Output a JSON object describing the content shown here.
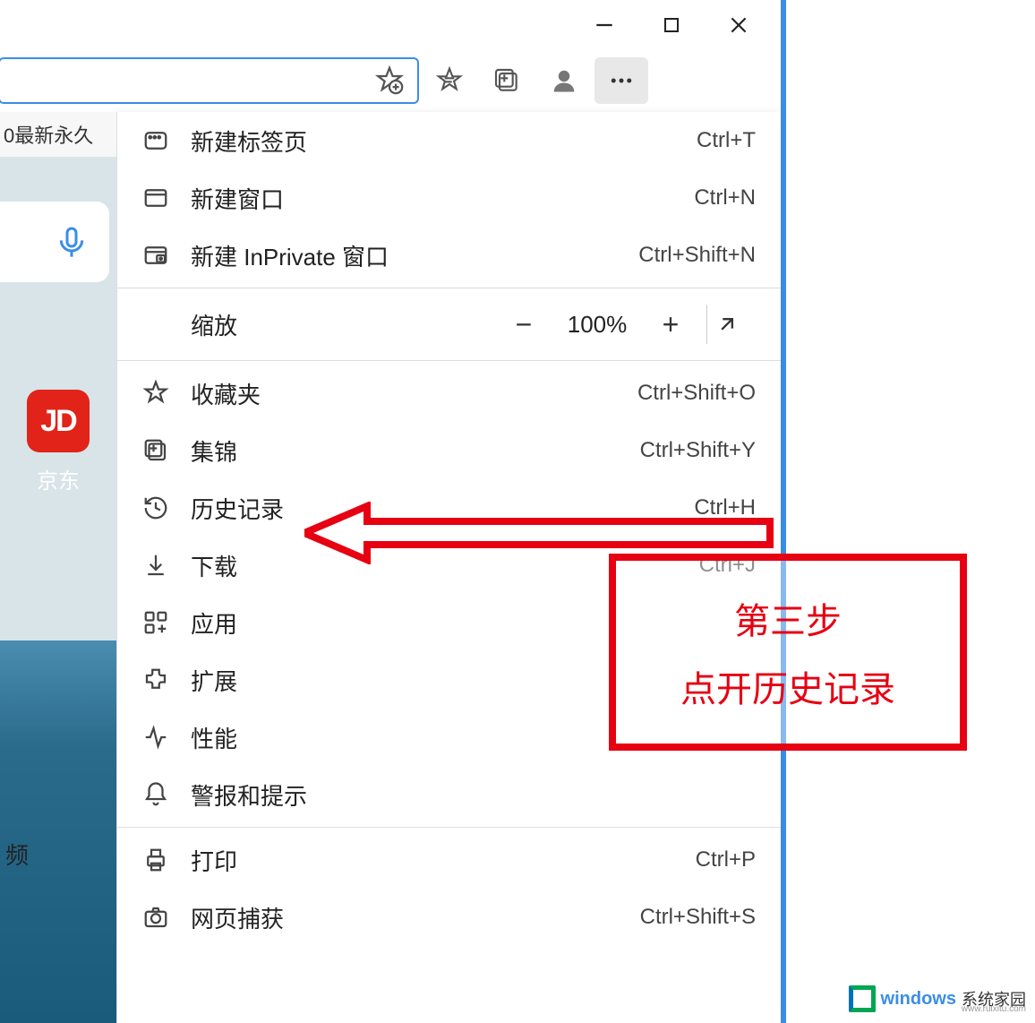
{
  "titlebar": {
    "minimize": "minimize",
    "maximize": "maximize",
    "close": "close"
  },
  "toolbar": {
    "favorites_icon": "favorites",
    "collections_icon": "collections",
    "profile_icon": "profile",
    "more_icon": "more"
  },
  "bookmark_strip": "0最新永久",
  "page": {
    "jd_icon_text": "JD",
    "jd_label": "京东",
    "bottom_label": "频"
  },
  "menu": {
    "new_tab": {
      "label": "新建标签页",
      "shortcut": "Ctrl+T"
    },
    "new_window": {
      "label": "新建窗口",
      "shortcut": "Ctrl+N"
    },
    "new_inprivate": {
      "label": "新建 InPrivate 窗口",
      "shortcut": "Ctrl+Shift+N"
    },
    "zoom": {
      "label": "缩放",
      "value": "100%"
    },
    "favorites": {
      "label": "收藏夹",
      "shortcut": "Ctrl+Shift+O"
    },
    "collections": {
      "label": "集锦",
      "shortcut": "Ctrl+Shift+Y"
    },
    "history": {
      "label": "历史记录",
      "shortcut": "Ctrl+H"
    },
    "downloads": {
      "label": "下载",
      "shortcut": "Ctrl+J"
    },
    "apps": {
      "label": "应用",
      "shortcut": "›"
    },
    "extensions": {
      "label": "扩展",
      "shortcut": ""
    },
    "performance": {
      "label": "性能",
      "shortcut": ""
    },
    "alerts": {
      "label": "警报和提示",
      "shortcut": ""
    },
    "print": {
      "label": "打印",
      "shortcut": "Ctrl+P"
    },
    "web_capture": {
      "label": "网页捕获",
      "shortcut": "Ctrl+Shift+S"
    }
  },
  "annotation": {
    "line1": "第三步",
    "line2": "点开历史记录"
  },
  "watermark": {
    "brand": "windows",
    "suffix": "系统家园",
    "url": "www.ruixitu.com"
  }
}
